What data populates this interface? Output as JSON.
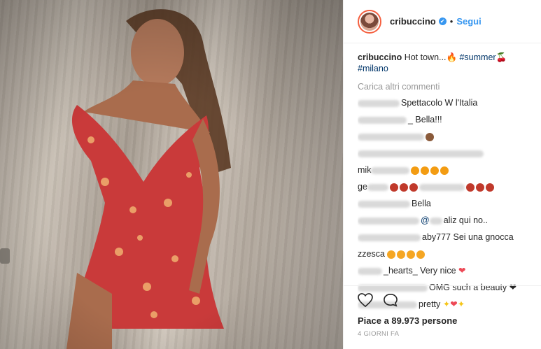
{
  "post": {
    "username": "cribuccino",
    "follow_label": "Segui",
    "dot": "•",
    "verified_mark": "✔",
    "caption": {
      "username": "cribuccino",
      "text": " Hot town...🔥 ",
      "tag1": "#summer",
      "emoji": "🍒",
      "tag2": "#milano"
    },
    "load_more": "Carica altri commenti",
    "comments": [
      {
        "text": "Spettacolo W l'Italia"
      },
      {
        "text": "_ Bella!!!"
      },
      {
        "text": ""
      },
      {
        "text": ""
      },
      {
        "text": "mik"
      },
      {
        "text": "ge"
      },
      {
        "text": "Bella"
      },
      {
        "text": "@",
        "text2": "aliz qui no.."
      },
      {
        "text": "aby777 Sei una gnocca"
      },
      {
        "text": "zzesca"
      },
      {
        "text": "_hearts_ Very nice"
      },
      {
        "text": "OMG such a beauty"
      },
      {
        "text": "pretty"
      }
    ],
    "likes": "Piace a 89.973 persone",
    "time": "4 GIORNI FA"
  },
  "colors": {
    "accent": "#3897f0",
    "like": "#ed4956"
  },
  "icons": [
    "heart-icon",
    "comment-icon",
    "verified-icon"
  ]
}
